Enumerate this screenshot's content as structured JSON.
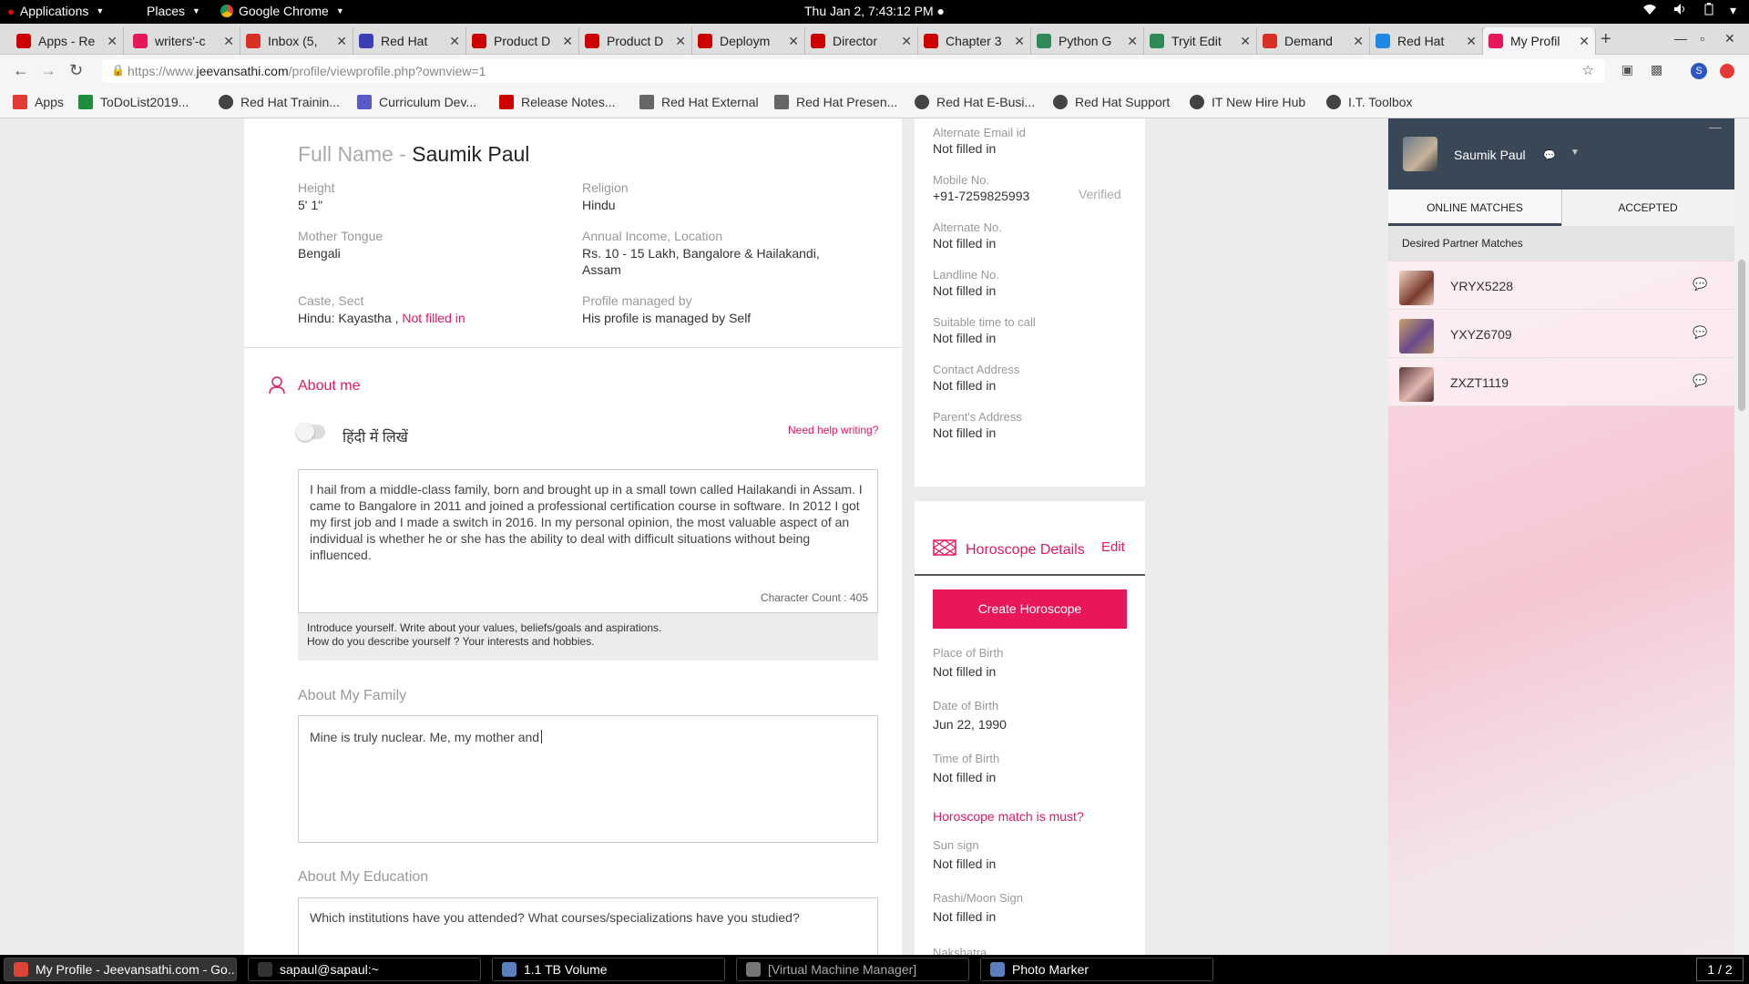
{
  "topbar": {
    "applications": "Applications",
    "places": "Places",
    "browser": "Google Chrome",
    "clock": "Thu Jan  2,  7:43:12 PM ●"
  },
  "tabs": [
    {
      "label": "Apps - Re",
      "color": "#cc0000"
    },
    {
      "label": "writers'-c",
      "color": "#e7175a"
    },
    {
      "label": "Inbox (5,",
      "color": "#d93025"
    },
    {
      "label": "Red Hat",
      "color": "#3b3fb6"
    },
    {
      "label": "Product D",
      "color": "#cc0000"
    },
    {
      "label": "Product D",
      "color": "#cc0000"
    },
    {
      "label": "Deploym",
      "color": "#cc0000"
    },
    {
      "label": "Director",
      "color": "#cc0000"
    },
    {
      "label": "Chapter 3",
      "color": "#cc0000"
    },
    {
      "label": "Python G",
      "color": "#2e8b57"
    },
    {
      "label": "Tryit Edit",
      "color": "#2e8b57"
    },
    {
      "label": "Demand",
      "color": "#d93025"
    },
    {
      "label": "Red Hat",
      "color": "#1e88e5"
    },
    {
      "label": "My Profil",
      "color": "#e7175a"
    }
  ],
  "url": {
    "prefix": "https://www.",
    "domain": "jeevansathi.com",
    "rest": "/profile/viewprofile.php?ownview=1"
  },
  "bookmarks": [
    {
      "label": "Apps"
    },
    {
      "label": "ToDoList2019..."
    },
    {
      "label": "Red Hat Trainin..."
    },
    {
      "label": "Curriculum Dev..."
    },
    {
      "label": "Release Notes..."
    },
    {
      "label": "Red Hat External"
    },
    {
      "label": "Red Hat Presen..."
    },
    {
      "label": "Red Hat E-Busi..."
    },
    {
      "label": "Red Hat Support"
    },
    {
      "label": "IT New Hire Hub"
    },
    {
      "label": "I.T. Toolbox"
    }
  ],
  "profile": {
    "fullname_label": "Full Name",
    "fullname_sep": " - ",
    "fullname": "Saumik Paul",
    "height_label": "Height",
    "height": "5' 1\"",
    "religion_label": "Religion",
    "religion": "Hindu",
    "tongue_label": "Mother Tongue",
    "tongue": "Bengali",
    "income_label": "Annual Income, Location",
    "income_line1": "Rs. 10 - 15 Lakh, Bangalore & Hailakandi,",
    "income_line2": "Assam",
    "caste_label": "Caste, Sect",
    "caste": "Hindu: Kayastha ,",
    "caste_nf": "Not filled in",
    "managed_label": "Profile managed by",
    "managed": "His profile is managed by Self"
  },
  "about": {
    "title": "About me",
    "hindi_toggle": "हिंदी में लिखें",
    "help": "Need help writing?",
    "text": "I hail from a middle-class family, born and brought up in a small town called Hailakandi in Assam. I came to Bangalore in 2011 and joined a professional certification course in software. In 2012 I got my first job and I made a switch in 2016. In my personal opinion, the most valuable aspect of an individual is whether he or she has the ability to deal with difficult situations without being influenced.",
    "char_count": "Character Count : 405",
    "hint1": "Introduce yourself. Write about your values, beliefs/goals and aspirations.",
    "hint2": "How do you describe yourself ? Your interests and hobbies.",
    "family_label": "About My Family",
    "family_text": "Mine is truly nuclear. Me, my mother and",
    "education_label": "About My Education",
    "education_placeholder": "Which institutions have you attended? What courses/specializations have you studied?"
  },
  "contact": {
    "alt_email_label": "Alternate Email id",
    "alt_email": "Not filled in",
    "mobile_label": "Mobile No.",
    "mobile": "+91-7259825993",
    "verified": "Verified",
    "alt_no_label": "Alternate No.",
    "alt_no": "Not filled in",
    "landline_label": "Landline No.",
    "landline": "Not filled in",
    "call_time_label": "Suitable time to call",
    "call_time": "Not filled in",
    "address_label": "Contact Address",
    "address": "Not filled in",
    "parent_address_label": "Parent's Address",
    "parent_address": "Not filled in"
  },
  "horoscope": {
    "title": "Horoscope Details",
    "edit": "Edit",
    "create": "Create Horoscope",
    "pob_label": "Place of Birth",
    "pob": "Not filled in",
    "dob_label": "Date of Birth",
    "dob": "Jun 22, 1990",
    "tob_label": "Time of Birth",
    "tob": "Not filled in",
    "must": "Horoscope match is must?",
    "sun_label": "Sun sign",
    "sun": "Not filled in",
    "moon_label": "Rashi/Moon Sign",
    "moon": "Not filled in",
    "nakshatra_label": "Nakshatra"
  },
  "chat": {
    "user": "Saumik Paul",
    "tab_online": "ONLINE MATCHES",
    "tab_accepted": "ACCEPTED",
    "desired": "Desired Partner Matches",
    "matches": [
      {
        "id": "YRYX5228"
      },
      {
        "id": "YXYZ6709"
      },
      {
        "id": "ZXZT1119"
      }
    ]
  },
  "taskbar": {
    "items": [
      {
        "label": "My Profile - Jeevansathi.com - Go..."
      },
      {
        "label": "sapaul@sapaul:~"
      },
      {
        "label": "1.1 TB Volume"
      },
      {
        "label": "[Virtual Machine Manager]"
      },
      {
        "label": "Photo Marker"
      }
    ],
    "pager": "1 / 2"
  },
  "colors": {
    "accent": "#e7175a",
    "chat_header": "#3a4756"
  }
}
